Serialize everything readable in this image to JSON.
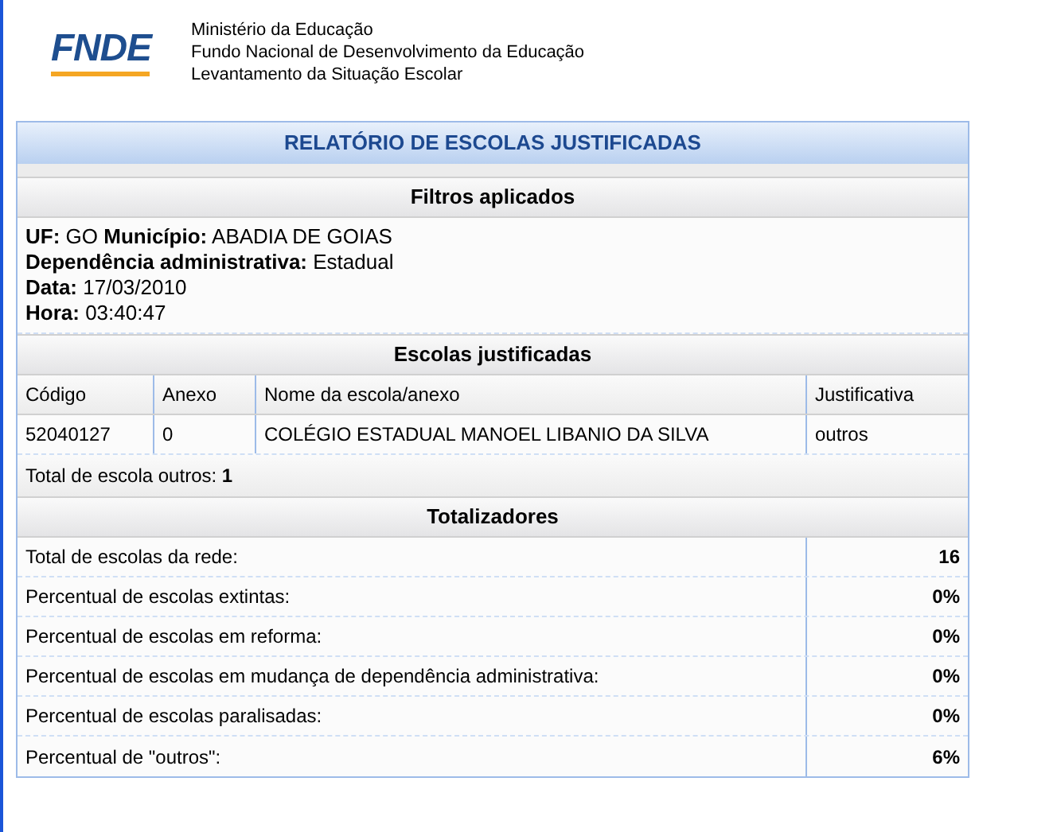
{
  "header": {
    "logo": "FNDE",
    "lines": [
      "Ministério da Educação",
      "Fundo Nacional de Desenvolvimento da Educação",
      "Levantamento da Situação Escolar"
    ]
  },
  "report": {
    "title": "RELATÓRIO DE ESCOLAS JUSTIFICADAS",
    "filters": {
      "heading": "Filtros aplicados",
      "lines": [
        "**UF:** GO **Município:** ABADIA DE GOIAS",
        "**Dependência administrativa:** Estadual",
        "**Data:** 17/03/2010",
        "**Hora:** 03:40:47"
      ]
    },
    "schools": {
      "heading": "Escolas justificadas",
      "columns": [
        "Código",
        "Anexo",
        "Nome da escola/anexo",
        "Justificativa"
      ],
      "rows": [
        [
          "52040127",
          "0",
          "COLÉGIO ESTADUAL MANOEL LIBANIO DA SILVA",
          "outros"
        ]
      ],
      "total": "Total de escola outros: **1**"
    },
    "totals": {
      "heading": "Totalizadores",
      "rows": [
        {
          "label": "Total de escolas da rede:",
          "value": "16"
        },
        {
          "label": "Percentual de escolas extintas:",
          "value": "0%"
        },
        {
          "label": "Percentual de escolas em reforma:",
          "value": "0%"
        },
        {
          "label": "Percentual de escolas em mudança de dependência administrativa:",
          "value": "0%"
        },
        {
          "label": "Percentual de escolas paralisadas:",
          "value": "0%"
        },
        {
          "label": "Percentual de \"outros\":",
          "value": "6%"
        }
      ]
    }
  }
}
